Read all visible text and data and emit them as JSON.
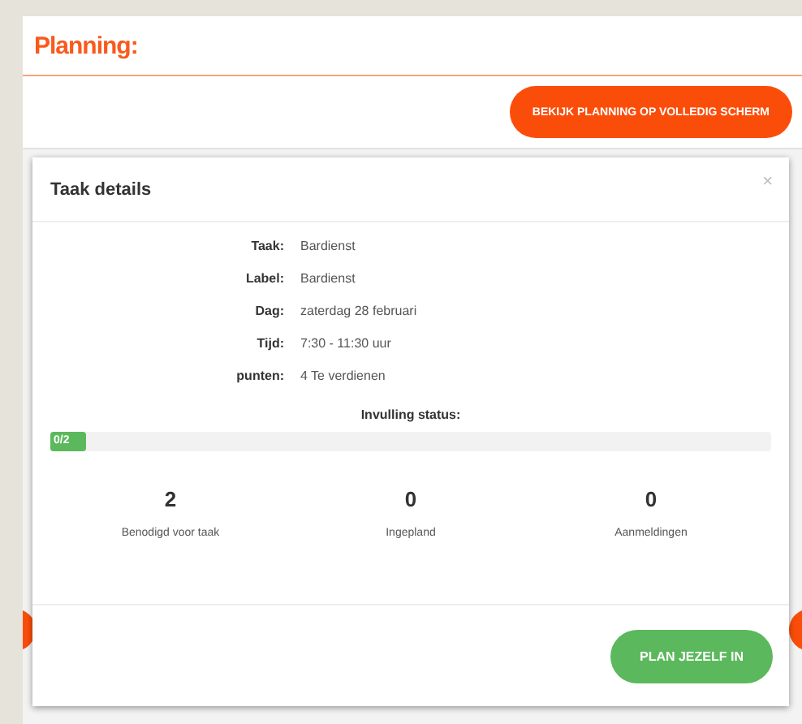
{
  "page": {
    "title": "Planning:",
    "fullscreen_button": "BEKIJK PLANNING OP VOLLEDIG SCHERM"
  },
  "modal": {
    "title": "Taak details",
    "close": "×",
    "details": [
      {
        "label": "Taak:",
        "value": "Bardienst"
      },
      {
        "label": "Label:",
        "value": "Bardienst"
      },
      {
        "label": "Dag:",
        "value": "zaterdag 28 februari"
      },
      {
        "label": "Tijd:",
        "value": "7:30 - 11:30 uur"
      },
      {
        "label": "punten:",
        "value": "4 Te verdienen"
      }
    ],
    "status": {
      "heading": "Invulling status:",
      "progress_text": "0/2",
      "level": 0.05
    },
    "stats": [
      {
        "value": "2",
        "label": "Benodigd voor taak"
      },
      {
        "value": "0",
        "label": "Ingepland"
      },
      {
        "value": "0",
        "label": "Aanmeldingen"
      }
    ],
    "action_button": "PLAN JEZELF IN"
  }
}
